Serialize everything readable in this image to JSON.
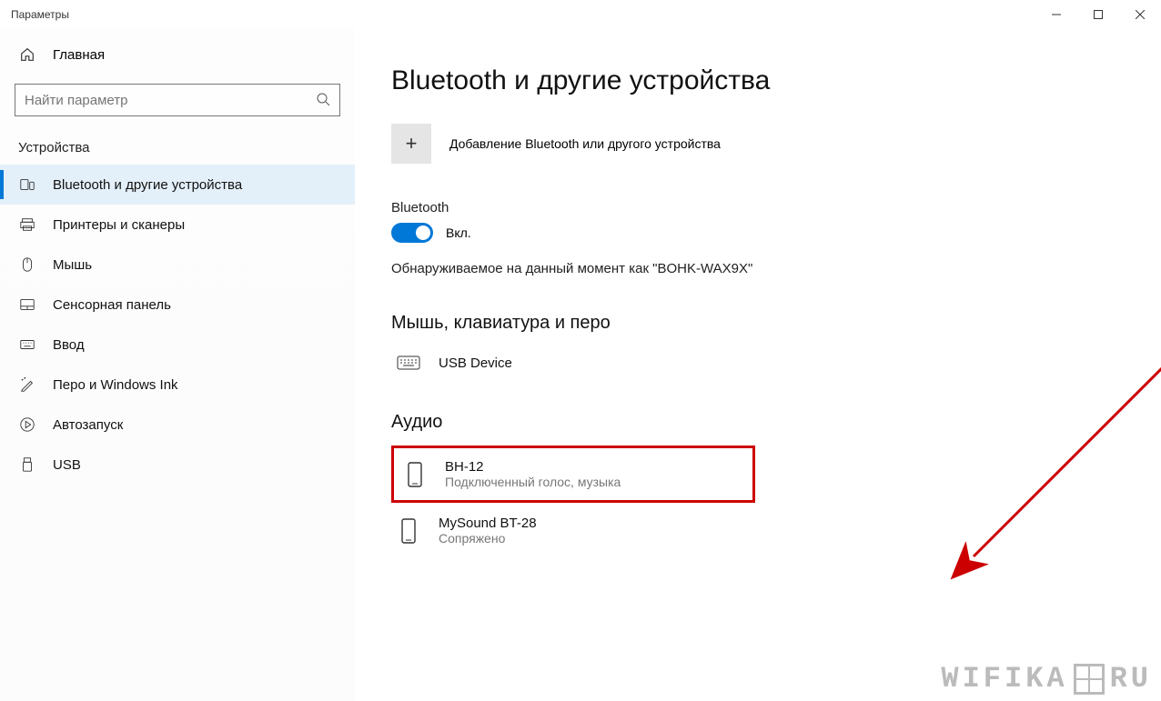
{
  "window": {
    "title": "Параметры"
  },
  "sidebar": {
    "home": "Главная",
    "search_placeholder": "Найти параметр",
    "section": "Устройства",
    "items": [
      {
        "label": "Bluetooth и другие устройства",
        "icon": "devices",
        "selected": true
      },
      {
        "label": "Принтеры и сканеры",
        "icon": "printer",
        "selected": false
      },
      {
        "label": "Мышь",
        "icon": "mouse",
        "selected": false
      },
      {
        "label": "Сенсорная панель",
        "icon": "touchpad",
        "selected": false
      },
      {
        "label": "Ввод",
        "icon": "keyboard",
        "selected": false
      },
      {
        "label": "Перо и Windows Ink",
        "icon": "pen",
        "selected": false
      },
      {
        "label": "Автозапуск",
        "icon": "autoplay",
        "selected": false
      },
      {
        "label": "USB",
        "icon": "usb",
        "selected": false
      }
    ]
  },
  "main": {
    "title": "Bluetooth и другие устройства",
    "add_label": "Добавление Bluetooth или другого устройства",
    "bt_section_label": "Bluetooth",
    "toggle_state": "Вкл.",
    "discoverable": "Обнаруживаемое на данный момент как \"BOHK-WAX9X\"",
    "group_mouse": "Мышь, клавиатура и перо",
    "usb_device": "USB Device",
    "group_audio": "Аудио",
    "audio_devices": [
      {
        "name": "BH-12",
        "status": "Подключенный голос, музыка"
      },
      {
        "name": "MySound BT-28",
        "status": "Сопряжено"
      }
    ]
  },
  "watermark": {
    "left": "WIFIKA",
    "right": "RU"
  }
}
